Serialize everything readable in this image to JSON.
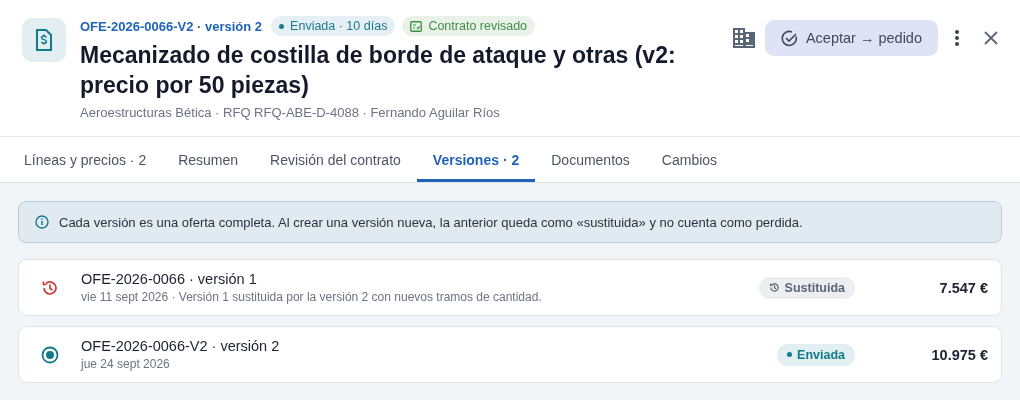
{
  "header": {
    "code": "OFE-2026-0066-V2 · versión 2",
    "badges": [
      {
        "kind": "status",
        "label": "Enviada · 10 días"
      },
      {
        "kind": "contract",
        "label": "Contrato revisado"
      }
    ],
    "title": "Mecanizado de costilla de borde de ataque y otras (v2: precio por 50 piezas)",
    "subtitle": "Aeroestructuras Bética · RFQ RFQ-ABE-D-4088 · Fernando Aguilar Ríos",
    "primary_action": "Aceptar → pedido"
  },
  "tabs": [
    {
      "label": "Líneas y precios · 2",
      "selected": false
    },
    {
      "label": "Resumen",
      "selected": false
    },
    {
      "label": "Revisión del contrato",
      "selected": false
    },
    {
      "label": "Versiones · 2",
      "selected": true
    },
    {
      "label": "Documentos",
      "selected": false
    },
    {
      "label": "Cambios",
      "selected": false
    }
  ],
  "notice": "Cada versión es una oferta completa. Al crear una versión nueva, la anterior queda como «sustituida» y no cuenta como perdida.",
  "versions": [
    {
      "kind": "superseded",
      "title": "OFE-2026-0066 · versión 1",
      "detail": "vie 11 sept 2026 · Versión 1 sustituida por la versión 2 con nuevos tramos de cantidad.",
      "status": "Sustituida",
      "amount": "7.547 €"
    },
    {
      "kind": "current",
      "title": "OFE-2026-0066-V2 · versión 2",
      "detail": "jue 24 sept 2026",
      "status": "Enviada",
      "amount": "10.975 €"
    }
  ]
}
